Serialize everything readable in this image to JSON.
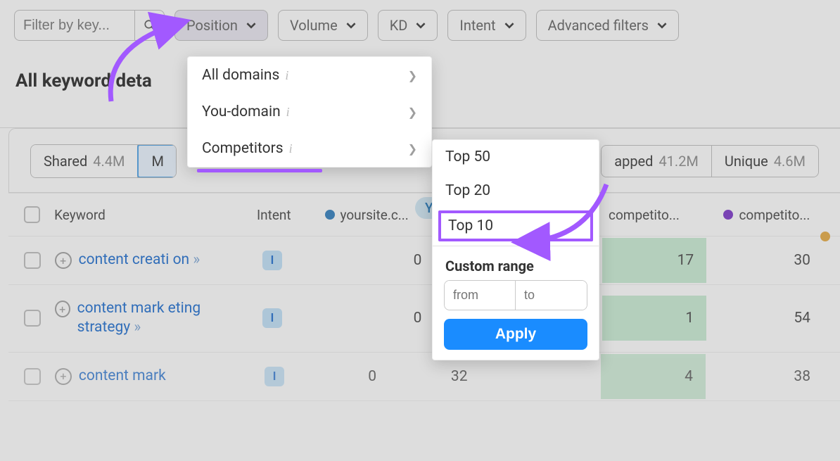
{
  "filters": {
    "input_placeholder": "Filter by key...",
    "position": "Position",
    "volume": "Volume",
    "kd": "KD",
    "intent": "Intent",
    "advanced": "Advanced filters"
  },
  "section_title": "All keyword deta",
  "you_badge": "You",
  "tabs": {
    "shared": {
      "label": "Shared",
      "count": "4.4M"
    },
    "missing_prefix": "M",
    "untapped": {
      "label": "apped",
      "count": "41.2M"
    },
    "unique": {
      "label": "Unique",
      "count": "4.6M"
    }
  },
  "columns": {
    "keyword": "Keyword",
    "intent": "Intent",
    "site1": "yoursite.c...",
    "comp1": "competito...",
    "comp2": "competito..."
  },
  "colors": {
    "site1": "#2b7bbd",
    "comp1": "#7a32c9",
    "comp3": "#e6a83e"
  },
  "rows": [
    {
      "kw": "content creati on",
      "intent": "I",
      "v1": "0",
      "v2": "17",
      "v3": "30"
    },
    {
      "kw": "content mark eting strategy",
      "intent": "I",
      "v1": "0",
      "v2": "1",
      "v3": "54"
    },
    {
      "kw": "content mark",
      "intent": "I",
      "v1": "0",
      "v1b": "32",
      "v2": "4",
      "v3": "38"
    }
  ],
  "dd1": {
    "all": "All domains",
    "you": "You-domain",
    "comp": "Competitors"
  },
  "dd2": {
    "top50": "Top 50",
    "top20": "Top 20",
    "top10": "Top 10",
    "custom": "Custom range",
    "from_ph": "from",
    "to_ph": "to",
    "apply": "Apply"
  }
}
